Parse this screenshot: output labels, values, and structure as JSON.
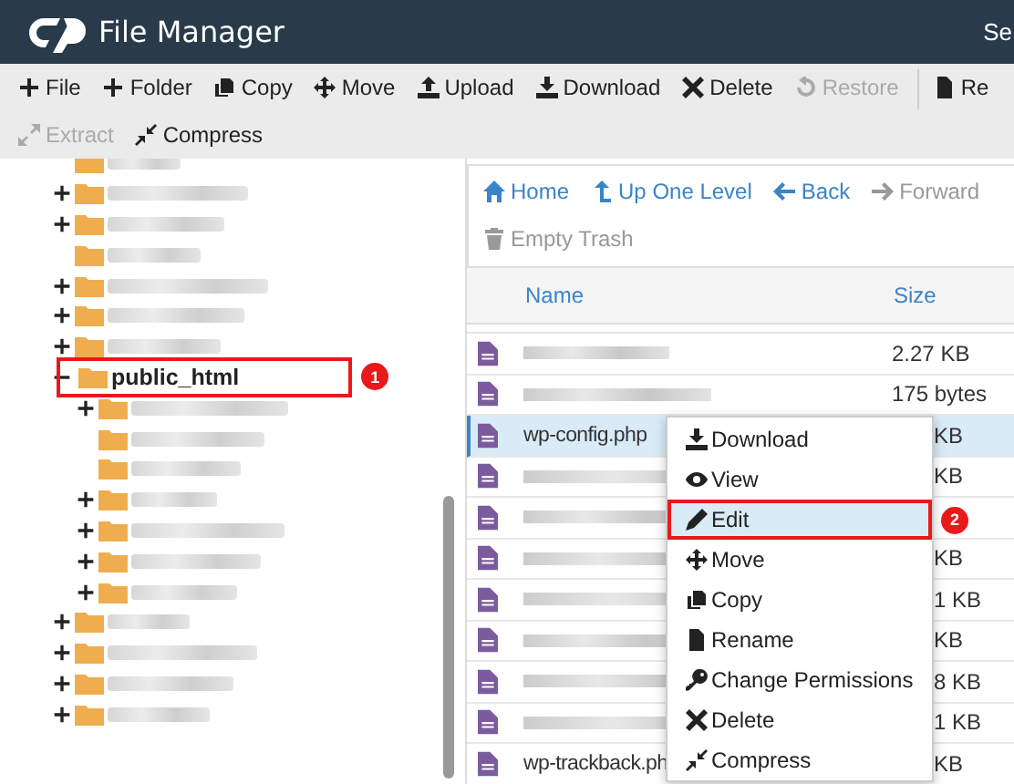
{
  "header": {
    "title": "File Manager",
    "search_partial": "Se"
  },
  "toolbar": [
    {
      "label": "File",
      "disabled": false
    },
    {
      "label": "Folder",
      "disabled": false
    },
    {
      "label": "Copy",
      "disabled": false
    },
    {
      "label": "Move",
      "disabled": false
    },
    {
      "label": "Upload",
      "disabled": false
    },
    {
      "label": "Download",
      "disabled": false
    },
    {
      "label": "Delete",
      "disabled": false
    },
    {
      "label": "Restore",
      "disabled": true
    },
    {
      "label": "Re",
      "disabled": false
    },
    {
      "label": "Extract",
      "disabled": true
    },
    {
      "label": "Compress",
      "disabled": false
    }
  ],
  "tree": [
    {
      "kind": "blurred"
    },
    {
      "kind": "blurred",
      "expanded": false
    },
    {
      "kind": "blurred",
      "expanded": false
    },
    {
      "kind": "blurred"
    },
    {
      "kind": "blurred",
      "expanded": false
    },
    {
      "kind": "blurred",
      "expanded": false
    },
    {
      "kind": "blurred",
      "expanded": false
    },
    {
      "kind": "text",
      "label": "public_html",
      "expanded": true,
      "highlighted": true,
      "badge": "1",
      "children": [
        {
          "kind": "blurred",
          "expanded": false
        },
        {
          "kind": "blurred"
        },
        {
          "kind": "blurred"
        },
        {
          "kind": "blurred",
          "expanded": false
        },
        {
          "kind": "blurred",
          "expanded": false
        },
        {
          "kind": "blurred",
          "expanded": false
        },
        {
          "kind": "blurred",
          "expanded": false
        }
      ]
    },
    {
      "kind": "blurred",
      "expanded": false
    },
    {
      "kind": "blurred",
      "expanded": false
    },
    {
      "kind": "blurred",
      "expanded": false
    },
    {
      "kind": "blurred",
      "expanded": false
    }
  ],
  "nav": [
    {
      "label": "Home",
      "disabled": false
    },
    {
      "label": "Up One Level",
      "disabled": false
    },
    {
      "label": "Back",
      "disabled": false
    },
    {
      "label": "Forward",
      "disabled": true
    },
    {
      "label": "Empty Trash",
      "disabled": true
    }
  ],
  "table": {
    "columns": [
      "Name",
      "Size"
    ],
    "rows": [
      {
        "kind": "blurred",
        "size": "2.27 KB",
        "selected": false,
        "covered": false
      },
      {
        "kind": "blurred",
        "size": "175 bytes",
        "selected": false,
        "covered": false
      },
      {
        "kind": "text",
        "name": "wp-config.php",
        "size": "KB",
        "selected": true,
        "covered": true
      },
      {
        "kind": "blurred",
        "size": "KB",
        "selected": false,
        "covered": true
      },
      {
        "kind": "blurred",
        "selected": false
      },
      {
        "kind": "blurred",
        "size": "KB",
        "selected": false,
        "covered": true
      },
      {
        "kind": "blurred",
        "size": "1 KB",
        "selected": false,
        "covered": true
      },
      {
        "kind": "blurred",
        "size": "KB",
        "selected": false,
        "covered": true
      },
      {
        "kind": "blurred",
        "size": "8 KB",
        "selected": false,
        "covered": true
      },
      {
        "kind": "blurred",
        "size": "1 KB",
        "selected": false,
        "covered": true
      },
      {
        "kind": "text",
        "name": "wp-trackback.ph",
        "size": "KB",
        "selected": false,
        "covered": true
      }
    ]
  },
  "context_menu": [
    {
      "label": "Download",
      "selected": false
    },
    {
      "label": "View",
      "selected": false
    },
    {
      "label": "Edit",
      "selected": true,
      "badge": "2"
    },
    {
      "label": "Move",
      "selected": false
    },
    {
      "label": "Copy",
      "selected": false
    },
    {
      "label": "Rename",
      "selected": false
    },
    {
      "label": "Change Permissions",
      "selected": false
    },
    {
      "label": "Delete",
      "selected": false
    },
    {
      "label": "Compress",
      "selected": false
    }
  ]
}
